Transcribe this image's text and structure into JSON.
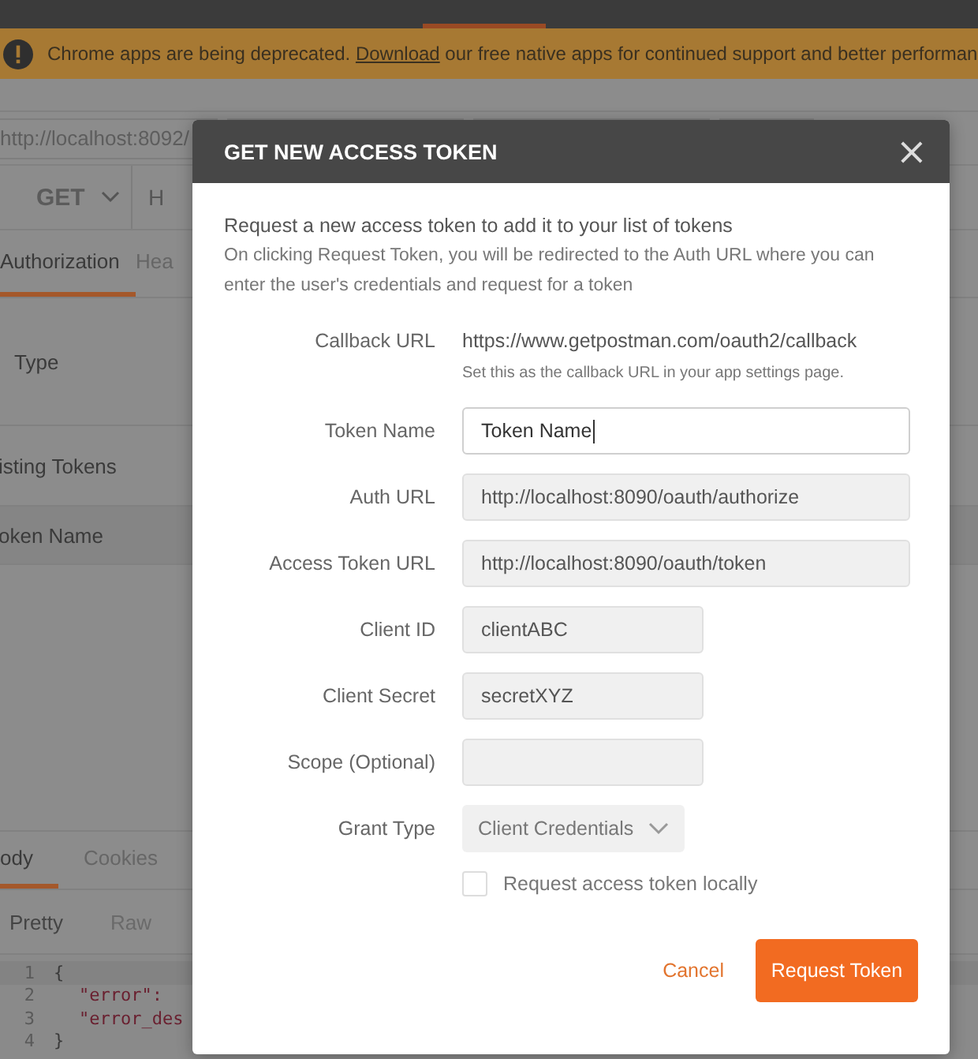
{
  "banner": {
    "text_before": "Chrome apps are being deprecated.",
    "link": "Download",
    "text_after": "our free native apps for continued support and better performan"
  },
  "request_tab": {
    "url": "http://localhost:8092/"
  },
  "request": {
    "method": "GET",
    "url_field": "H"
  },
  "request_tabs": [
    {
      "label": "Authorization",
      "selected": true
    },
    {
      "label": "Hea",
      "selected": false
    }
  ],
  "auth": {
    "type_label": "Type",
    "existing_label": "isting Tokens",
    "column_label": "oken Name"
  },
  "response_tabs": [
    {
      "label": "ody",
      "selected": true
    },
    {
      "label": "Cookies",
      "selected": false
    }
  ],
  "view_tabs": [
    {
      "label": "Pretty",
      "selected": true
    },
    {
      "label": "Raw",
      "selected": false
    }
  ],
  "code_lines": [
    {
      "number": "1",
      "text": "{"
    },
    {
      "number": "2",
      "text": "\"error\":"
    },
    {
      "number": "3",
      "text": "\"error_des"
    },
    {
      "number": "4",
      "text": "}"
    }
  ],
  "dialog": {
    "title": "GET NEW ACCESS TOKEN",
    "close": "×",
    "intro": "Request a new access token to add it to your list of tokens",
    "description": "On clicking Request Token, you will be redirected to the Auth URL where you can enter the user's credentials and request for a token",
    "fields": [
      {
        "kind": "static",
        "label": "Callback URL",
        "value": "https://www.getpostman.com/oauth2/callback",
        "hint": "Set this as the callback URL in your app settings page."
      },
      {
        "kind": "long",
        "label": "Token Name",
        "value": "Token Name",
        "focused": true
      },
      {
        "kind": "long",
        "label": "Auth URL",
        "value": "http://localhost:8090/oauth/authorize",
        "focused": false
      },
      {
        "kind": "long",
        "label": "Access Token URL",
        "value": "http://localhost:8090/oauth/token",
        "focused": false
      },
      {
        "kind": "short",
        "label": "Client ID",
        "value": "clientABC",
        "focused": false
      },
      {
        "kind": "short",
        "label": "Client Secret",
        "value": "secretXYZ",
        "focused": false
      },
      {
        "kind": "short",
        "label": "Scope (Optional)",
        "focused": false
      },
      {
        "kind": "select",
        "label": "Grant Type",
        "value": "Client Credentials"
      }
    ],
    "checkbox": {
      "label": "Request access token locally",
      "checked": false
    },
    "cancel": "Cancel",
    "submit": "Request Token"
  }
}
